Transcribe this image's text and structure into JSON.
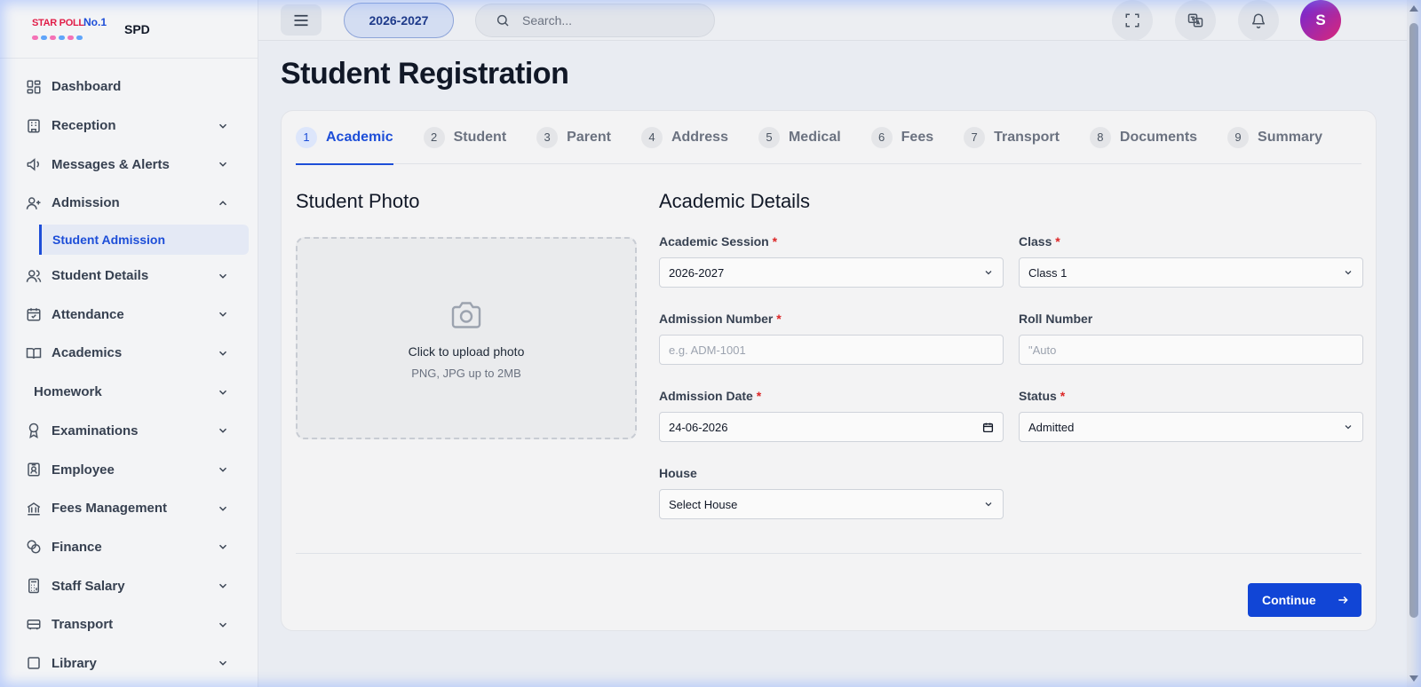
{
  "brand": {
    "logo_text": "STAR POLL",
    "logo_badge": "No.1",
    "name": "SPD"
  },
  "sidebar": {
    "items": [
      {
        "label": "Dashboard",
        "icon": "dashboard-icon"
      },
      {
        "label": "Reception",
        "icon": "building-icon"
      },
      {
        "label": "Messages & Alerts",
        "icon": "megaphone-icon"
      },
      {
        "label": "Admission",
        "icon": "user-plus-icon",
        "expanded": true,
        "children": [
          "Student Admission"
        ]
      },
      {
        "label": "Student Details",
        "icon": "users-icon"
      },
      {
        "label": "Attendance",
        "icon": "calendar-check-icon"
      },
      {
        "label": "Academics",
        "icon": "book-icon"
      },
      {
        "label": "Homework",
        "icon": ""
      },
      {
        "label": "Examinations",
        "icon": "award-icon"
      },
      {
        "label": "Employee",
        "icon": "id-badge-icon"
      },
      {
        "label": "Fees Management",
        "icon": "bank-icon"
      },
      {
        "label": "Finance",
        "icon": "coins-icon"
      },
      {
        "label": "Staff Salary",
        "icon": "calculator-icon"
      },
      {
        "label": "Transport",
        "icon": "bus-icon"
      },
      {
        "label": "Library",
        "icon": "library-icon"
      }
    ],
    "sub_active": "Student Admission"
  },
  "topbar": {
    "session": "2026-2027",
    "search_placeholder": "Search...",
    "avatar_initial": "S"
  },
  "page": {
    "title": "Student Registration"
  },
  "steps": [
    {
      "num": "1",
      "label": "Academic",
      "active": true
    },
    {
      "num": "2",
      "label": "Student"
    },
    {
      "num": "3",
      "label": "Parent"
    },
    {
      "num": "4",
      "label": "Address"
    },
    {
      "num": "5",
      "label": "Medical"
    },
    {
      "num": "6",
      "label": "Fees"
    },
    {
      "num": "7",
      "label": "Transport"
    },
    {
      "num": "8",
      "label": "Documents"
    },
    {
      "num": "9",
      "label": "Summary"
    }
  ],
  "photo": {
    "title": "Student Photo",
    "upload_text": "Click to upload photo",
    "upload_hint": "PNG, JPG up to 2MB"
  },
  "academic": {
    "title": "Academic Details",
    "session_label": "Academic Session",
    "session_value": "2026-2027",
    "class_label": "Class",
    "class_value": "Class 1",
    "admission_number_label": "Admission Number",
    "admission_number_placeholder": "e.g. ADM-1001",
    "roll_number_label": "Roll Number",
    "roll_number_placeholder": "\"Auto",
    "admission_date_label": "Admission Date",
    "admission_date_value": "24-06-2026",
    "status_label": "Status",
    "status_value": "Admitted",
    "house_label": "House",
    "house_value": "Select House",
    "required_mark": "*"
  },
  "actions": {
    "continue_label": "Continue"
  }
}
